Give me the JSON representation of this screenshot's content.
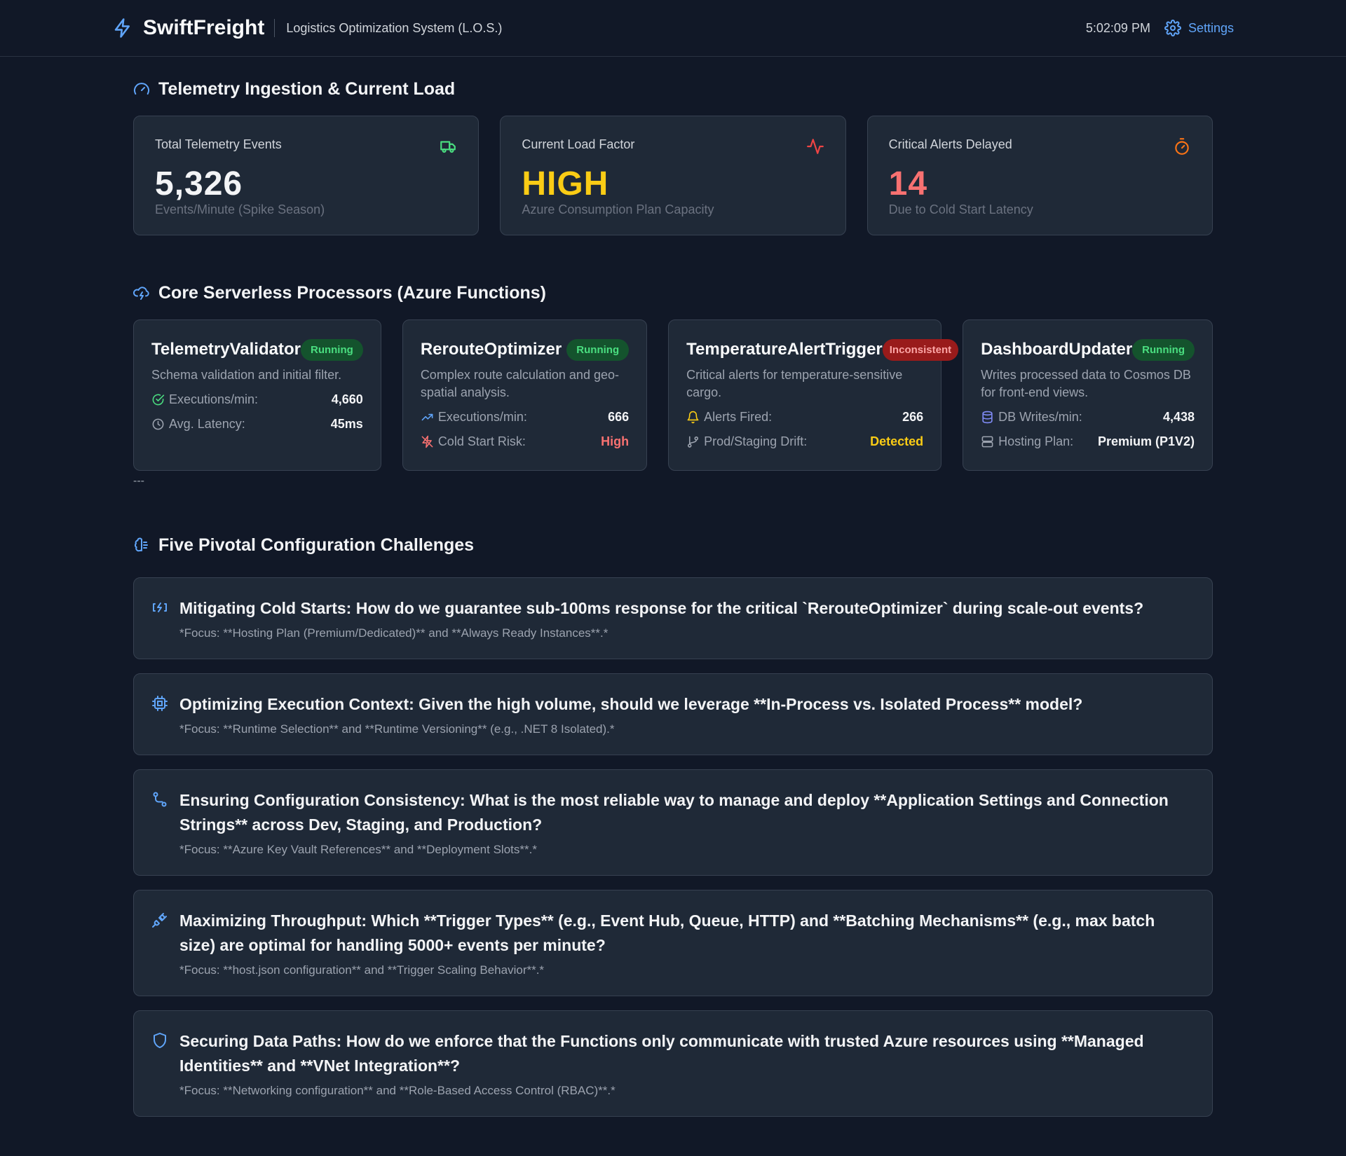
{
  "header": {
    "brand": "SwiftFreight",
    "subtitle": "Logistics Optimization System (L.O.S.)",
    "time": "5:02:09 PM",
    "settings_label": "Settings"
  },
  "telemetry": {
    "title": "Telemetry Ingestion & Current Load",
    "cards": [
      {
        "label": "Total Telemetry Events",
        "value": "5,326",
        "sub": "Events/Minute (Spike Season)",
        "icon": "truck-icon",
        "color": "#f3f4f6"
      },
      {
        "label": "Current Load Factor",
        "value": "HIGH",
        "sub": "Azure Consumption Plan Capacity",
        "icon": "activity-icon",
        "color": "#facc15"
      },
      {
        "label": "Critical Alerts Delayed",
        "value": "14",
        "sub": "Due to Cold Start Latency",
        "icon": "timer-icon",
        "color": "#f87171"
      }
    ]
  },
  "processors": {
    "title": "Core Serverless Processors (Azure Functions)",
    "functions": [
      {
        "name": "TelemetryValidator",
        "status": "Running",
        "desc": "Schema validation and initial filter.",
        "metrics": [
          {
            "label": "Executions/min:",
            "value": "4,660",
            "icon": "check-circle-icon"
          },
          {
            "label": "Avg. Latency:",
            "value": "45ms",
            "icon": "clock-icon"
          }
        ]
      },
      {
        "name": "RerouteOptimizer",
        "status": "Running",
        "desc": "Complex route calculation and geo-spatial analysis.",
        "metrics": [
          {
            "label": "Executions/min:",
            "value": "666",
            "icon": "trending-up-icon"
          },
          {
            "label": "Cold Start Risk:",
            "value": "High",
            "icon": "zap-off-icon"
          }
        ]
      },
      {
        "name": "TemperatureAlertTrigger",
        "status": "Inconsistent",
        "desc": "Critical alerts for temperature-sensitive cargo.",
        "metrics": [
          {
            "label": "Alerts Fired:",
            "value": "266",
            "icon": "bell-icon"
          },
          {
            "label": "Prod/Staging Drift:",
            "value": "Detected",
            "icon": "git-branch-icon"
          }
        ]
      },
      {
        "name": "DashboardUpdater",
        "status": "Running",
        "desc": "Writes processed data to Cosmos DB for front-end views.",
        "metrics": [
          {
            "label": "DB Writes/min:",
            "value": "4,438",
            "icon": "database-icon"
          },
          {
            "label": "Hosting Plan:",
            "value": "Premium (P1V2)",
            "icon": "server-icon"
          }
        ]
      }
    ],
    "divider": "---"
  },
  "challenges": {
    "title": "Five Pivotal Configuration Challenges",
    "items": [
      {
        "icon": "power-bolt-icon",
        "title": "Mitigating Cold Starts: How do we guarantee sub-100ms response for the critical `RerouteOptimizer` during scale-out events?",
        "focus": "*Focus: **Hosting Plan (Premium/Dedicated)** and **Always Ready Instances**.*"
      },
      {
        "icon": "cpu-icon",
        "title": "Optimizing Execution Context: Given the high volume, should we leverage **In-Process vs. Isolated Process** model?",
        "focus": "*Focus: **Runtime Selection** and **Runtime Versioning** (e.g., .NET 8 Isolated).*"
      },
      {
        "icon": "route-icon",
        "title": "Ensuring Configuration Consistency: What is the most reliable way to manage and deploy **Application Settings and Connection Strings** across Dev, Staging, and Production?",
        "focus": "*Focus: **Azure Key Vault References** and **Deployment Slots**.*"
      },
      {
        "icon": "plug-icon",
        "title": "Maximizing Throughput: Which **Trigger Types** (e.g., Event Hub, Queue, HTTP) and **Batching Mechanisms** (e.g., max batch size) are optimal for handling 5000+ events per minute?",
        "focus": "*Focus: **host.json configuration** and **Trigger Scaling Behavior**.*"
      },
      {
        "icon": "shield-icon",
        "title": "Securing Data Paths: How do we enforce that the Functions only communicate with trusted Azure resources using **Managed Identities** and **VNet Integration**?",
        "focus": "*Focus: **Networking configuration** and **Role-Based Access Control (RBAC)**.*"
      }
    ]
  },
  "colors": {
    "background": "#111827",
    "card": "#1f2937",
    "accent": "#60a5fa",
    "success": "#4ade80",
    "warning": "#facc15",
    "danger": "#f87171"
  }
}
